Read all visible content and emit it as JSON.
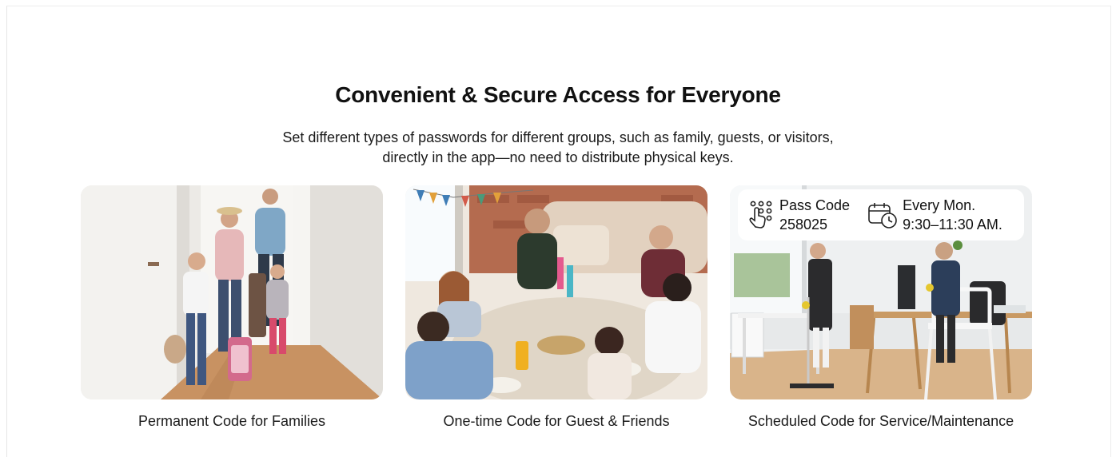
{
  "heading": {
    "title": "Convenient & Secure Access for Everyone",
    "subtitle_line1": "Set different types of passwords for different groups, such as family, guests, or visitors,",
    "subtitle_line2": "directly in the app—no need to distribute physical keys."
  },
  "cards": [
    {
      "caption": "Permanent Code for Families",
      "photo": "family-walking-through-door"
    },
    {
      "caption": "One-time Code for Guest & Friends",
      "photo": "friends-toasting-at-dinner-table"
    },
    {
      "caption": "Scheduled Code for Service/Maintenance",
      "photo": "cleaning-staff-in-office"
    }
  ],
  "schedule_overlay": {
    "pass_code_label": "Pass Code",
    "pass_code_value": "258025",
    "schedule_label": "Every Mon.",
    "schedule_time": "9:30–11:30 AM.",
    "icons": [
      "keypad-touch-icon",
      "calendar-clock-icon"
    ]
  }
}
